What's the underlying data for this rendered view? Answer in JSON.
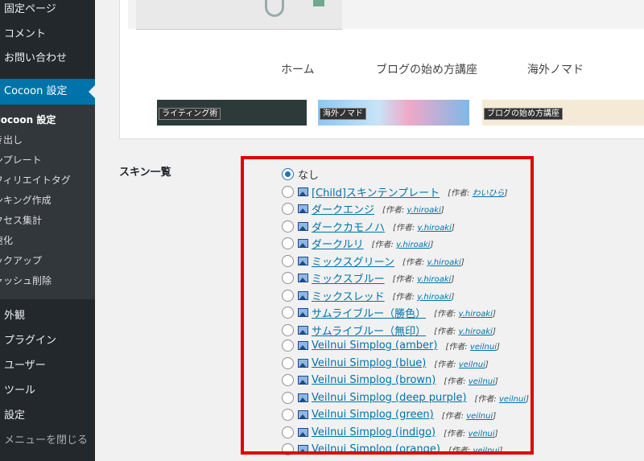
{
  "sidebar": {
    "items_top": [
      {
        "label": "固定ページ"
      },
      {
        "label": "コメント"
      },
      {
        "label": "お問い合わせ"
      }
    ],
    "active": {
      "label": "Cocoon 設定"
    },
    "submenu": [
      {
        "label": "Cocoon 設定"
      },
      {
        "label": "き出し"
      },
      {
        "label": "ンプレート"
      },
      {
        "label": "フィリエイトタグ"
      },
      {
        "label": "ンキング作成"
      },
      {
        "label": "クセス集計"
      },
      {
        "label": "速化"
      },
      {
        "label": "ックアップ"
      },
      {
        "label": "ャッシュ削除"
      }
    ],
    "items_bottom": [
      {
        "label": "外観"
      },
      {
        "label": "プラグイン"
      },
      {
        "label": "ユーザー"
      },
      {
        "label": "ツール"
      },
      {
        "label": "設定"
      },
      {
        "label": "メニューを閉じる"
      }
    ]
  },
  "preview": {
    "nav": [
      "ホーム",
      "ブログの始め方講座",
      "海外ノマド"
    ],
    "thumbs": [
      {
        "caption": "ライティング術",
        "color": "#2c3b3a"
      },
      {
        "caption": "海外ノマド",
        "color": "#7fb8e8"
      },
      {
        "caption": "ブログの始め方講座",
        "color": "#f5e6c8"
      }
    ]
  },
  "skins": {
    "label": "スキン一覧",
    "author_prefix": "[作者:",
    "author_suffix": "]",
    "items": [
      {
        "name": "なし",
        "author": "",
        "checked": true
      },
      {
        "name": "[Child]スキンテンプレート",
        "author": "わいひら"
      },
      {
        "name": "ダークエンジ",
        "author": "y.hiroaki"
      },
      {
        "name": "ダークカモノハ",
        "author": "y.hiroaki"
      },
      {
        "name": "ダークルリ",
        "author": "y.hiroaki"
      },
      {
        "name": "ミックスグリーン",
        "author": "y.hiroaki"
      },
      {
        "name": "ミックスブルー",
        "author": "y.hiroaki"
      },
      {
        "name": "ミックスレッド",
        "author": "y.hiroaki"
      },
      {
        "name": "サムライブルー（勝色）",
        "author": "y.hiroaki"
      },
      {
        "name": "サムライブルー（無印）",
        "author": "y.hiroaki"
      },
      {
        "name": "Veilnui Simplog (amber)",
        "author": "veilnui"
      },
      {
        "name": "Veilnui Simplog (blue)",
        "author": "veilnui"
      },
      {
        "name": "Veilnui Simplog (brown)",
        "author": "veilnui"
      },
      {
        "name": "Veilnui Simplog (deep purple)",
        "author": "veilnui"
      },
      {
        "name": "Veilnui Simplog (green)",
        "author": "veilnui"
      },
      {
        "name": "Veilnui Simplog (indigo)",
        "author": "veilnui"
      },
      {
        "name": "Veilnui Simplog (orange)",
        "author": "veilnui"
      }
    ]
  },
  "colors": {
    "highlight_box": "#e00000",
    "accent": "#0073aa"
  }
}
